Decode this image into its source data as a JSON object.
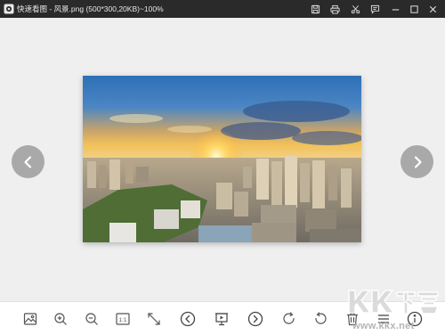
{
  "window": {
    "title": "快速看图 - 风景.png (500*300,20KB)~100%",
    "titlebar_icons": [
      "save-icon",
      "print-icon",
      "crop-icon",
      "edit-note-icon",
      "minimize-icon",
      "maximize-icon",
      "close-icon"
    ]
  },
  "viewer": {
    "image_description_icon": "landscape-photo",
    "prev_icon": "chevron-left-icon",
    "next_icon": "chevron-right-icon"
  },
  "toolbar": {
    "actual_size_label": "1:1",
    "tools": [
      "image-icon",
      "zoom-in-icon",
      "zoom-out-icon",
      "actual-size-icon",
      "fit-screen-icon",
      "previous-icon",
      "slideshow-icon",
      "next-icon",
      "rotate-right-icon",
      "rotate-left-icon",
      "delete-icon",
      "menu-icon",
      "info-icon"
    ]
  },
  "watermark": {
    "url": "www.kkx.net"
  },
  "colors": {
    "titlebar": "#2a2a2a",
    "viewer_bg": "#efefef",
    "nav_arrow": "#a9a9a9",
    "toolbar_icon": "#555555"
  }
}
